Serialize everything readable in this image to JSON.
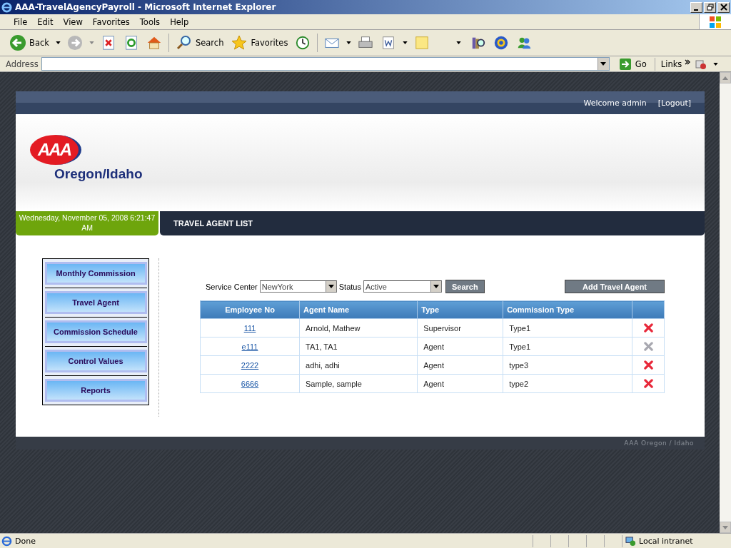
{
  "window": {
    "title": "AAA-TravelAgencyPayroll - Microsoft Internet Explorer"
  },
  "menu": [
    "File",
    "Edit",
    "View",
    "Favorites",
    "Tools",
    "Help"
  ],
  "toolbar": {
    "back": "Back",
    "search": "Search",
    "favorites": "Favorites"
  },
  "address_bar": {
    "label": "Address",
    "go": "Go",
    "links": "Links"
  },
  "page": {
    "welcome": "Welcome admin",
    "logout": "[Logout]",
    "logo": {
      "mark": "AAA",
      "name": "Oregon/Idaho"
    },
    "date": "Wednesday, November 05, 2008 6:21:47 AM",
    "section_title": "TRAVEL AGENT LIST",
    "nav": [
      "Monthly Commission",
      "Travel Agent",
      "Commission Schedule",
      "Control Values",
      "Reports"
    ],
    "filters": {
      "service_center_label": "Service Center",
      "service_center": "NewYork",
      "status_label": "Status",
      "status": "Active",
      "search": "Search"
    },
    "add_button": "Add Travel Agent",
    "table": {
      "columns": [
        "Employee No",
        "Agent Name",
        "Type",
        "Commission Type"
      ],
      "rows": [
        {
          "employee_no": "111",
          "agent_name": "Arnold, Mathew",
          "type": "Supervisor",
          "commission_type": "Type1",
          "disabled": false
        },
        {
          "employee_no": "e111",
          "agent_name": "TA1, TA1",
          "type": "Agent",
          "commission_type": "Type1",
          "disabled": true
        },
        {
          "employee_no": "2222",
          "agent_name": "adhi, adhi",
          "type": "Agent",
          "commission_type": "type3",
          "disabled": false
        },
        {
          "employee_no": "6666",
          "agent_name": "Sample, sample",
          "type": "Agent",
          "commission_type": "type2",
          "disabled": false
        }
      ]
    },
    "footer": "AAA Oregon / Idaho"
  },
  "status_bar": {
    "text": "Done",
    "zone": "Local intranet"
  }
}
